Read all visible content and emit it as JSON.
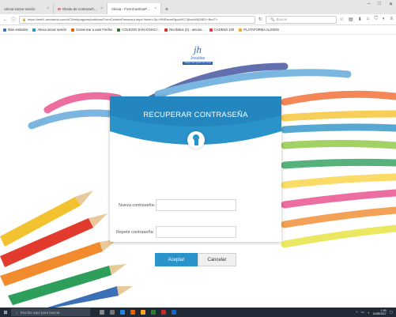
{
  "browser": {
    "tabs": [
      {
        "title": "Alexia iniciar sesión",
        "active": false
      },
      {
        "title": "Olvido de contraseña para ...",
        "active": false,
        "mail": true
      },
      {
        "title": "Alexia - FormCambioPassword",
        "active": true
      }
    ],
    "new_tab": "+",
    "url": "https://web1.alexiaedu.com/ACWeb/paginas/publicas/FormCambioPassword.aspx?token=3p=9WRacreEgop9XC3j9nzW6Z8ED+Bm/T+",
    "search_placeholder": "Buscar",
    "bookmarks": [
      {
        "label": "Más visitados",
        "color": "#3b73c4"
      },
      {
        "label": "Alexia iniciar sesión",
        "color": "#2a93c9"
      },
      {
        "label": "Comenzar a usar Firefox",
        "color": "#e66000"
      },
      {
        "label": "COLEGIO SAN IGNACI...",
        "color": "#2e7d32"
      },
      {
        "label": "Recibidos (3) - amuno...",
        "color": "#d93025"
      },
      {
        "label": "CADENA 100",
        "color": "#e53935"
      },
      {
        "label": "PLATAFORMA ALISIOS",
        "color": "#f9a825"
      }
    ]
  },
  "logo": {
    "mark": "jh",
    "word": "Jesuitas",
    "band": "Colegio San Ignacio de Loyola"
  },
  "form": {
    "title": "RECUPERAR CONTRASEÑA",
    "new_password_label": "Nueva contraseña:",
    "repeat_password_label": "Repetir contraseña:",
    "new_password_value": "",
    "repeat_password_value": "",
    "accept_label": "Aceptar",
    "cancel_label": "Cancelar"
  },
  "taskbar": {
    "search_placeholder": "Escribe aquí para buscar",
    "time": "1:00",
    "date": "11/08/2017"
  },
  "colors": {
    "accent": "#2a93c9",
    "header_dark": "#1f7db8"
  }
}
